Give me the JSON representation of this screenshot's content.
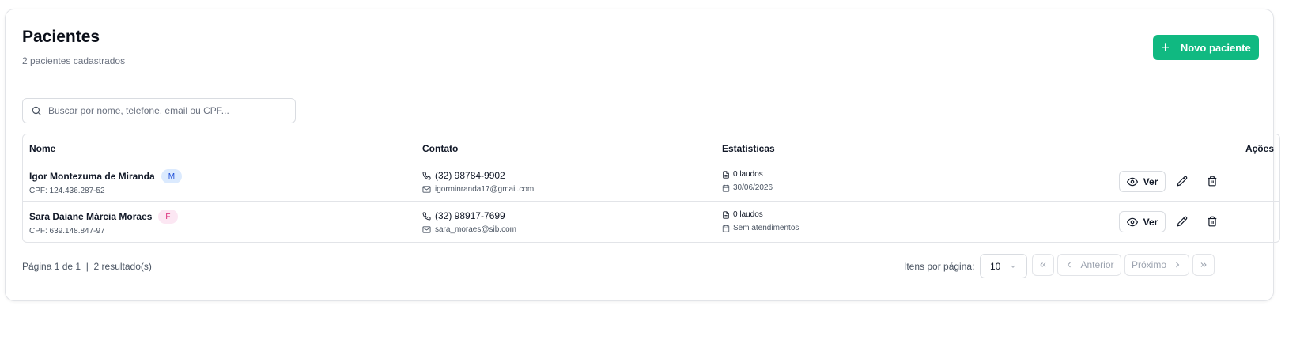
{
  "header": {
    "title": "Pacientes",
    "subtitle": "2 pacientes cadastrados",
    "new_button_label": "Novo paciente"
  },
  "search": {
    "placeholder": "Buscar por nome, telefone, email ou CPF..."
  },
  "table": {
    "columns": [
      "Nome",
      "Contato",
      "Estatísticas",
      "Ações"
    ],
    "rows": [
      {
        "name": "Igor Montezuma de Miranda",
        "gender_badge": "M",
        "cpf": "CPF: 124.436.287-52",
        "phone": "(32) 98784-9902",
        "email": "igorminranda17@gmail.com",
        "laudos": "0 laudos",
        "last_visit": "30/06/2026",
        "view_label": "Ver"
      },
      {
        "name": "Sara Daiane Márcia Moraes",
        "gender_badge": "F",
        "cpf": "CPF: 639.148.847-97",
        "phone": "(32) 98917-7699",
        "email": "sara_moraes@sib.com",
        "laudos": "0 laudos",
        "last_visit": "Sem atendimentos",
        "view_label": "Ver"
      }
    ]
  },
  "footer": {
    "page_info": "Página 1 de 1  |  2 resultado(s)",
    "per_page_label": "Itens por página:",
    "per_page_value": "10",
    "prev_label": "Anterior",
    "next_label": "Próximo"
  },
  "colors": {
    "accent": "#10b981",
    "badge_m_bg": "#dbeafe",
    "badge_f_bg": "#fce7f3"
  }
}
